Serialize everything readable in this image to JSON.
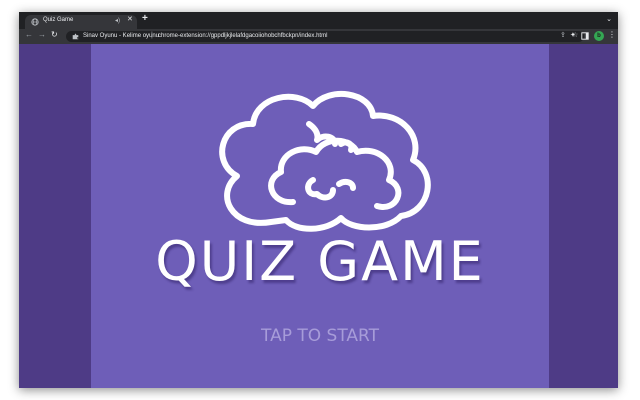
{
  "browser": {
    "tab": {
      "title": "Quiz Game",
      "audio_icon": "speaker-icon",
      "close_icon": "close-icon"
    },
    "new_tab_label": "+",
    "tab_search_icon": "chevron-down-icon",
    "toolbar": {
      "back_icon": "arrow-left-icon",
      "forward_icon": "arrow-right-icon",
      "reload_icon": "reload-icon"
    },
    "address_bar": {
      "site_name": "Sinav Oyunu - Kelime oyunu",
      "url": "chrome-extension://gppdljkjlelafdgacoiiohobchfbckpn/index.html"
    },
    "profile_initial": "b"
  },
  "game": {
    "title": "QUIZ GAME",
    "start_prompt": "TAP TO START"
  },
  "colors": {
    "page_background": "#4e3b86",
    "game_background": "#6e5eb8",
    "title_color": "#ffffff",
    "prompt_color": "#a79cd9"
  }
}
